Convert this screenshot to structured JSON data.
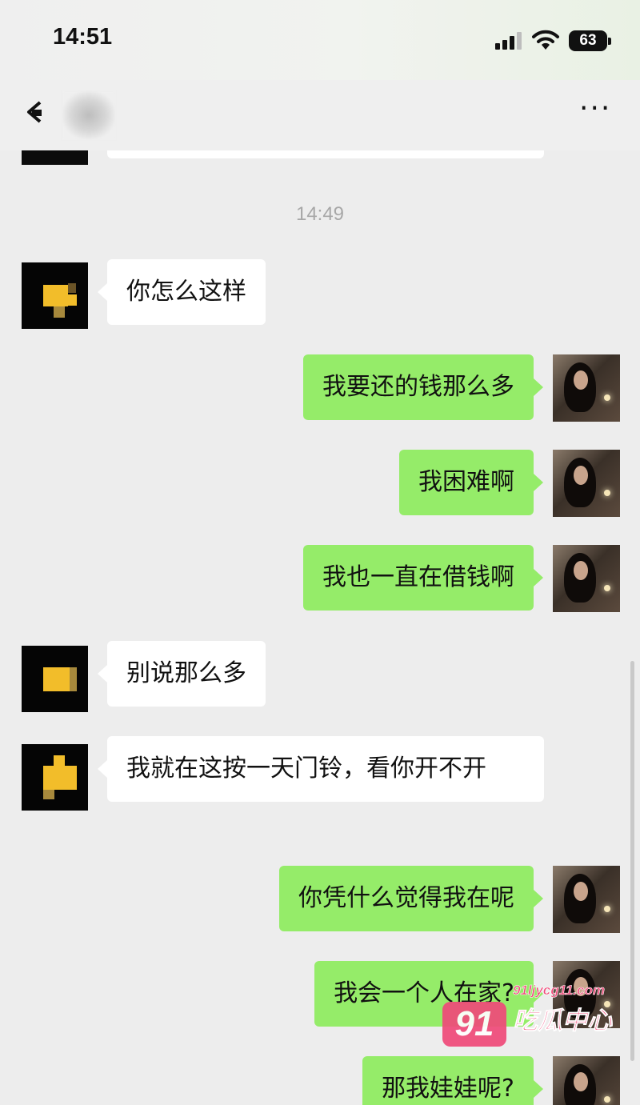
{
  "status_bar": {
    "time": "14:51",
    "battery": "63"
  },
  "nav": {
    "contact_name": "",
    "more": "···"
  },
  "chat": {
    "timestamp": "14:49",
    "messages": [
      {
        "side": "in",
        "text": "你怎么这样"
      },
      {
        "side": "out",
        "text": "我要还的钱那么多"
      },
      {
        "side": "out",
        "text": "我困难啊"
      },
      {
        "side": "out",
        "text": "我也一直在借钱啊"
      },
      {
        "side": "in",
        "text": "别说那么多"
      },
      {
        "side": "in",
        "text": "我就在这按一天门铃，看你开不开"
      },
      {
        "side": "out",
        "text": "你凭什么觉得我在呢"
      },
      {
        "side": "out",
        "text": "我会一个人在家?"
      },
      {
        "side": "out",
        "text": "那我娃娃呢?"
      }
    ]
  },
  "colors": {
    "chat_background": "#ededed",
    "incoming_bubble": "#ffffff",
    "outgoing_bubble": "#95ec69",
    "timestamp_text": "#a7a7a7"
  },
  "watermark": {
    "logo": "91",
    "url": "91ljycg11.com",
    "name": "吃瓜中心"
  }
}
